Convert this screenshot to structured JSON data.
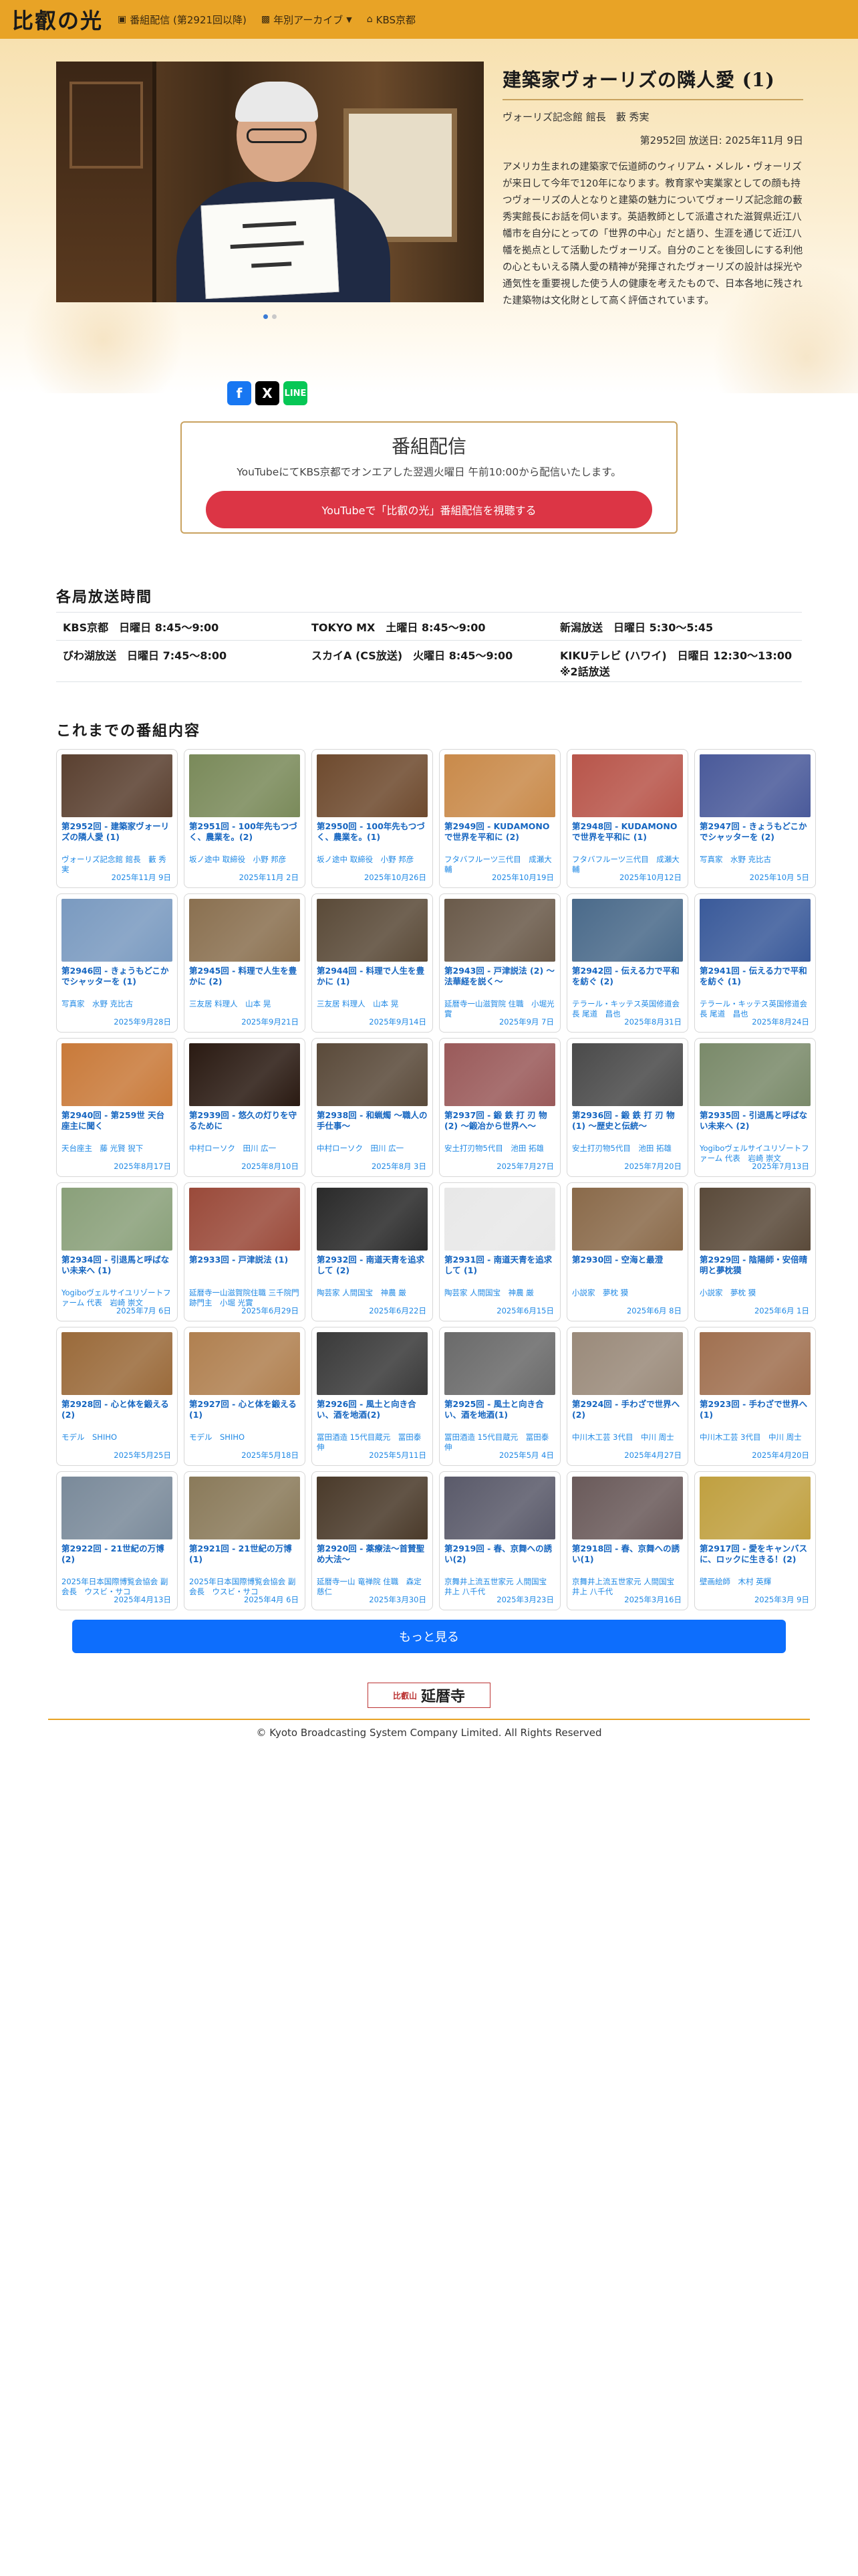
{
  "nav": {
    "brand": "比叡の光",
    "links": [
      {
        "label": "番組配信 (第2921回以降)",
        "icon": "video-camera-icon"
      },
      {
        "label": "年別アーカイブ",
        "icon": "archive-icon"
      },
      {
        "label": "KBS京都",
        "icon": "home-icon"
      }
    ]
  },
  "hero": {
    "title": "建築家ヴォーリズの隣人愛 (1)",
    "guest": "ヴォーリズ記念館 館長　藪 秀実",
    "meta": "第2952回 放送日: 2025年11月 9日",
    "description": "アメリカ生まれの建築家で伝道師のウィリアム・メレル・ヴォーリズが来日して今年で120年になります。教育家や実業家としての顔も持つヴォーリズの人となりと建築の魅力についてヴォーリズ記念館の藪秀実館長にお話を伺います。英語教師として派遣された滋賀県近江八幡市を自分にとっての「世界の中心」だと語り、生涯を通じて近江八幡を拠点として活動したヴォーリズ。自分のことを後回しにする利他の心ともいえる隣人愛の精神が発揮されたヴォーリズの設計は採光や通気性を重要視した使う人の健康を考えたもので、日本各地に残された建築物は文化財として高く評価されています。",
    "share": {
      "facebook": "f",
      "x": "X",
      "line": "LINE"
    }
  },
  "broadcast": {
    "title": "番組配信",
    "subtitle": "YouTubeにてKBS京都でオンエアした翌週火曜日 午前10:00から配信いたします。",
    "button": "YouTubeで「比叡の光」番組配信を視聴する"
  },
  "schedule": {
    "heading": "各局放送時間",
    "rows": [
      [
        "KBS京都　日曜日 8:45〜9:00",
        "TOKYO MX　土曜日 8:45〜9:00",
        "新潟放送　日曜日 5:30〜5:45"
      ],
      [
        "びわ湖放送　日曜日 7:45〜8:00",
        "スカイA (CS放送)　火曜日 8:45〜9:00",
        "KIKUテレビ (ハワイ)　日曜日 12:30〜13:00 ※2話放送"
      ]
    ]
  },
  "episodes_heading": "これまでの番組内容",
  "episodes": [
    {
      "title": "第2952回 - 建築家ヴォーリズの隣人愛 (1)",
      "guest": "ヴォーリズ記念館 館長　藪 秀実",
      "date": "2025年11月 9日",
      "color": "#5a4030"
    },
    {
      "title": "第2951回 - 100年先もつづく、農業を。(2)",
      "guest": "坂ノ途中 取締役　小野 邦彦",
      "date": "2025年11月 2日",
      "color": "#7a8a5a"
    },
    {
      "title": "第2950回 - 100年先もつづく、農業を。(1)",
      "guest": "坂ノ途中 取締役　小野 邦彦",
      "date": "2025年10月26日",
      "color": "#6e4a2e"
    },
    {
      "title": "第2949回 - KUDAMONOで世界を平和に (2)",
      "guest": "フタバフルーツ三代目　成瀬大輔",
      "date": "2025年10月19日",
      "color": "#c98a4a"
    },
    {
      "title": "第2948回 - KUDAMONOで世界を平和に (1)",
      "guest": "フタバフルーツ三代目　成瀬大輔",
      "date": "2025年10月12日",
      "color": "#b8554a"
    },
    {
      "title": "第2947回 - きょうもどこかでシャッターを (2)",
      "guest": "写真家　水野 克比古",
      "date": "2025年10月 5日",
      "color": "#4a5a9a"
    },
    {
      "title": "第2946回 - きょうもどこかでシャッターを (1)",
      "guest": "写真家　水野 克比古",
      "date": "2025年9月28日",
      "color": "#7a9ac0"
    },
    {
      "title": "第2945回 - 料理で人生を豊かに (2)",
      "guest": "三友居 料理人　山本 晃",
      "date": "2025年9月21日",
      "color": "#8a7050"
    },
    {
      "title": "第2944回 - 料理で人生を豊かに (1)",
      "guest": "三友居 料理人　山本 晃",
      "date": "2025年9月14日",
      "color": "#5a4a38"
    },
    {
      "title": "第2943回 - 戸津説法 (2) 〜法華経を説く〜",
      "guest": "延暦寺一山滋賀院 住職　小堀光實",
      "date": "2025年9月 7日",
      "color": "#6a5a4a"
    },
    {
      "title": "第2942回 - 伝える力で平和を紡ぐ (2)",
      "guest": "テラール・キッテス英国修道会長 尾道　昌也",
      "date": "2025年8月31日",
      "color": "#4a6a8a"
    },
    {
      "title": "第2941回 - 伝える力で平和を紡ぐ (1)",
      "guest": "テラール・キッテス英国修道会長 尾道　昌也",
      "date": "2025年8月24日",
      "color": "#3a5a9a"
    },
    {
      "title": "第2940回 - 第259世 天台座主に聞く",
      "guest": "天台座主　藤 光賢 猊下",
      "date": "2025年8月17日",
      "color": "#c97a3a"
    },
    {
      "title": "第2939回 - 悠久の灯りを守るために",
      "guest": "中村ローソク　田川 広一",
      "date": "2025年8月10日",
      "color": "#2a1a12"
    },
    {
      "title": "第2938回 - 和蝋燭 〜職人の手仕事〜",
      "guest": "中村ローソク　田川 広一",
      "date": "2025年8月 3日",
      "color": "#5a4a3a"
    },
    {
      "title": "第2937回 - 鍛 鉄 打 刃 物 (2) 〜鍛冶から世界へ〜",
      "guest": "安土打刃物5代目　池田 拓雄",
      "date": "2025年7月27日",
      "color": "#9a5a5a"
    },
    {
      "title": "第2936回 - 鍛 鉄 打 刃 物 (1) 〜歴史と伝統〜",
      "guest": "安土打刃物5代目　池田 拓雄",
      "date": "2025年7月20日",
      "color": "#4a4a4a"
    },
    {
      "title": "第2935回 - 引退馬と呼ばない未来へ (2)",
      "guest": "Yogiboヴェルサイユリゾートファーム 代表　岩崎 崇文",
      "date": "2025年7月13日",
      "color": "#7a8a6a"
    },
    {
      "title": "第2934回 - 引退馬と呼ばない未来へ (1)",
      "guest": "Yogiboヴェルサイユリゾートファーム 代表　岩崎 崇文",
      "date": "2025年7月 6日",
      "color": "#8aa07a"
    },
    {
      "title": "第2933回 - 戸津説法 (1)",
      "guest": "延暦寺一山滋賀院住職 三千院門跡門主　小堀 光實",
      "date": "2025年6月29日",
      "color": "#9a4a3a"
    },
    {
      "title": "第2932回 - 南道天青を追求して (2)",
      "guest": "陶芸家 人間国宝　神農 厳",
      "date": "2025年6月22日",
      "color": "#2a2a2a"
    },
    {
      "title": "第2931回 - 南道天青を追求して (1)",
      "guest": "陶芸家 人間国宝　神農 厳",
      "date": "2025年6月15日",
      "color": "#e8e8e8"
    },
    {
      "title": "第2930回 - 空海と最澄",
      "guest": "小説家　夢枕 獏",
      "date": "2025年6月 8日",
      "color": "#8a6a4a"
    },
    {
      "title": "第2929回 - 陰陽師・安倍晴明と夢枕獏",
      "guest": "小説家　夢枕 獏",
      "date": "2025年6月 1日",
      "color": "#5a4a3a"
    },
    {
      "title": "第2928回 - 心と体を鍛える (2)",
      "guest": "モデル　SHIHO",
      "date": "2025年5月25日",
      "color": "#9a6a3a"
    },
    {
      "title": "第2927回 - 心と体を鍛える (1)",
      "guest": "モデル　SHIHO",
      "date": "2025年5月18日",
      "color": "#b08050"
    },
    {
      "title": "第2926回 - 風土と向き合い、酒を地酒(2)",
      "guest": "冨田酒造 15代目蔵元　冨田泰伸",
      "date": "2025年5月11日",
      "color": "#3a3a3a"
    },
    {
      "title": "第2925回 - 風土と向き合い、酒を地酒(1)",
      "guest": "冨田酒造 15代目蔵元　冨田泰伸",
      "date": "2025年5月 4日",
      "color": "#6a6a6a"
    },
    {
      "title": "第2924回 - 手わざで世界へ(2)",
      "guest": "中川木工芸 3代目　中川 周士",
      "date": "2025年4月27日",
      "color": "#9a8a7a"
    },
    {
      "title": "第2923回 - 手わざで世界へ(1)",
      "guest": "中川木工芸 3代目　中川 周士",
      "date": "2025年4月20日",
      "color": "#a07050"
    },
    {
      "title": "第2922回 - 21世紀の万博 (2)",
      "guest": "2025年日本国際博覧会協会 副会長　ウスビ・サコ",
      "date": "2025年4月13日",
      "color": "#7a8a9a"
    },
    {
      "title": "第2921回 - 21世紀の万博 (1)",
      "guest": "2025年日本国際博覧会協会 副会長　ウスビ・サコ",
      "date": "2025年4月 6日",
      "color": "#8a7a5a"
    },
    {
      "title": "第2920回 - 薬療法〜首賛聖め大法〜",
      "guest": "延暦寺一山 竜禅院 住職　森定慈仁",
      "date": "2025年3月30日",
      "color": "#4a3a2a"
    },
    {
      "title": "第2919回 - 春、京舞への誘い(2)",
      "guest": "京舞井上流五世家元 人間国宝 井上 八千代",
      "date": "2025年3月23日",
      "color": "#5a5a6a"
    },
    {
      "title": "第2918回 - 春、京舞への誘い(1)",
      "guest": "京舞井上流五世家元 人間国宝 井上 八千代",
      "date": "2025年3月16日",
      "color": "#6a5a5a"
    },
    {
      "title": "第2917回 - 愛をキャンバスに、ロックに生きる！(2)",
      "guest": "壁画絵師　木村 英輝",
      "date": "2025年3月 9日",
      "color": "#c0a040"
    }
  ],
  "more_button": "もっと見る",
  "footer": {
    "logo_small": "比叡山",
    "logo_main": "延暦寺",
    "copyright": "© Kyoto Broadcasting System Company Limited. All Rights Reserved"
  }
}
